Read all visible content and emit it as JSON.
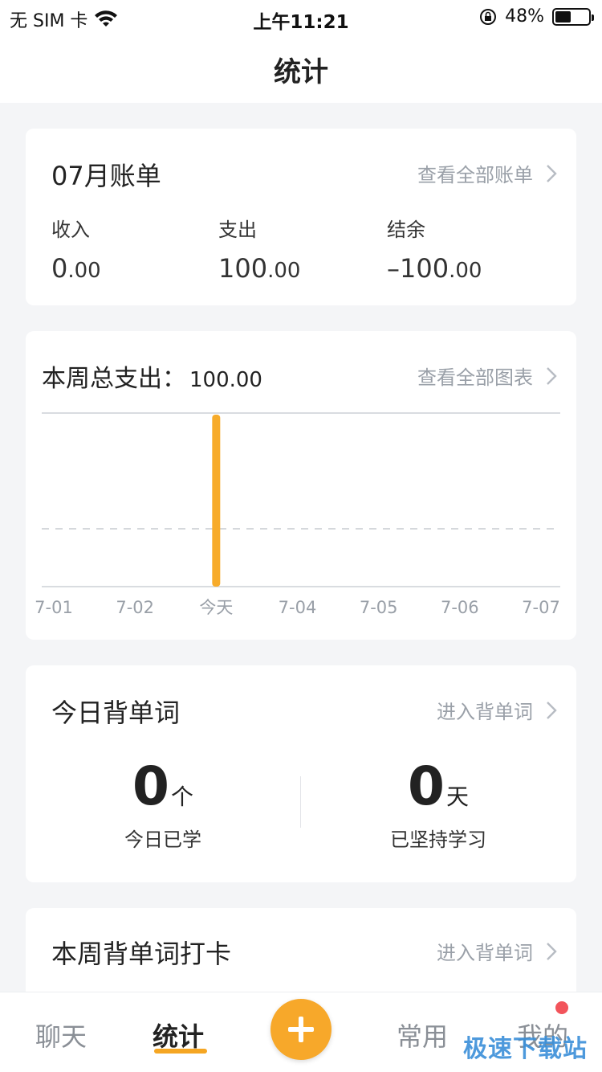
{
  "status_bar": {
    "carrier": "无 SIM 卡",
    "time": "上午11:21",
    "battery": "48%",
    "battery_level": 0.48
  },
  "header": {
    "title": "统计"
  },
  "bill_card": {
    "title": "07月账单",
    "link": "查看全部账单",
    "income": {
      "label": "收入",
      "int": "0",
      "dec": ".00"
    },
    "expense": {
      "label": "支出",
      "int": "100",
      "dec": ".00"
    },
    "balance": {
      "label": "结余",
      "int": "–100",
      "dec": ".00"
    }
  },
  "chart_card": {
    "title": "本周总支出：",
    "total": "100.00",
    "link": "查看全部图表"
  },
  "chart_data": {
    "type": "bar",
    "categories": [
      "7-01",
      "7-02",
      "今天",
      "7-04",
      "7-05",
      "7-06",
      "7-07"
    ],
    "values": [
      0,
      0,
      100,
      0,
      0,
      0,
      0
    ],
    "ylim": [
      0,
      100
    ],
    "grid": "dashed midline",
    "bar_color": "#f7ab2a"
  },
  "words_card": {
    "title": "今日背单词",
    "link": "进入背单词",
    "learned": {
      "value": "0",
      "unit": "个",
      "label": "今日已学"
    },
    "streak": {
      "value": "0",
      "unit": "天",
      "label": "已坚持学习"
    }
  },
  "checkin_card": {
    "title": "本周背单词打卡",
    "link": "进入背单词"
  },
  "tabbar": {
    "tabs": [
      {
        "label": "聊天"
      },
      {
        "label": "统计"
      },
      {
        "label": "常用"
      },
      {
        "label": "我的"
      }
    ],
    "active_color": "#f5a623"
  },
  "watermark": "极速下载站"
}
